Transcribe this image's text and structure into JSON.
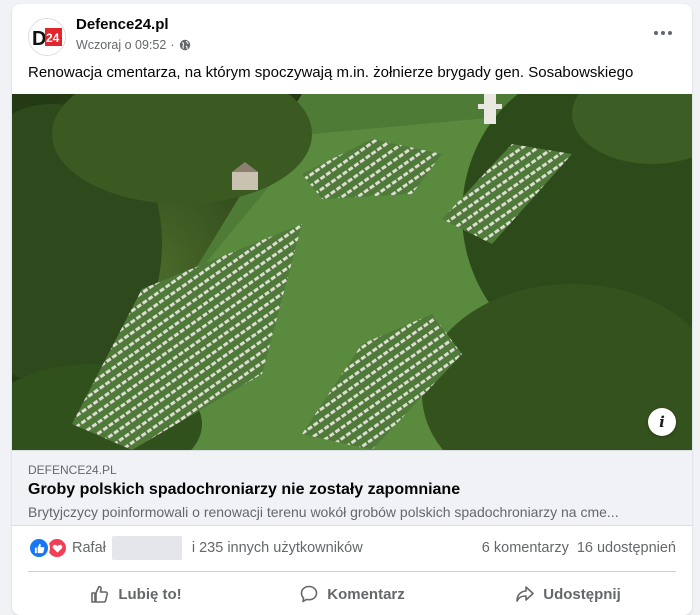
{
  "post": {
    "page_name": "Defence24.pl",
    "timestamp": "Wczoraj o 09:52",
    "separator": "·",
    "text": "Renowacja cmentarza, na którym spoczywają m.in. żołnierze brygady gen. Sosabowskiego",
    "avatar_logo": {
      "letter": "D",
      "number": "24"
    }
  },
  "link": {
    "domain": "DEFENCE24.PL",
    "title": "Groby polskich spadochroniarzy nie zostały zapomniane",
    "description": "Brytyjczycy poinformowali o renowacji terenu wokół grobów polskich spadochroniarzy na cme..."
  },
  "stats": {
    "reactor_prefix": "Rafał",
    "others": "i 235 innych użytkowników",
    "comments": "6 komentarzy",
    "shares": "16 udostępnień"
  },
  "actions": {
    "like": "Lubię to!",
    "comment": "Komentarz",
    "share": "Udostępnij"
  },
  "colors": {
    "brand": "#1877f2",
    "love": "#f33e58",
    "logo_red": "#e0262b"
  }
}
